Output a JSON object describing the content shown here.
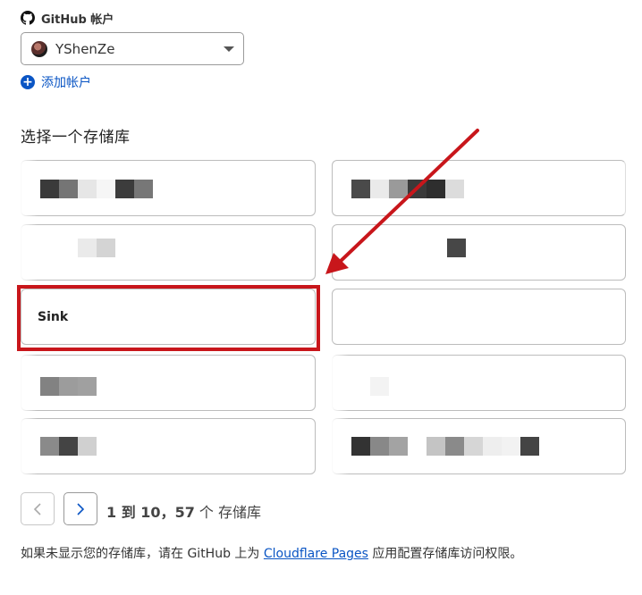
{
  "github_account": {
    "label": "GitHub 帐户",
    "selected_account": "YShenZe",
    "add_account": "添加帐户"
  },
  "repositories": {
    "title": "选择一个存储库",
    "highlighted_repo": "Sink"
  },
  "pagination": {
    "range_text": "1 到 10",
    "separator": "，",
    "count": "57",
    "unit": "个 存储库"
  },
  "footer": {
    "before": "如果未显示您的存储库，请在 GitHub 上为 ",
    "link": "Cloudflare Pages",
    "after": " 应用配置存储库访问权限。"
  },
  "colors": {
    "accent": "#0a55c4",
    "annotation": "#c8161b"
  }
}
